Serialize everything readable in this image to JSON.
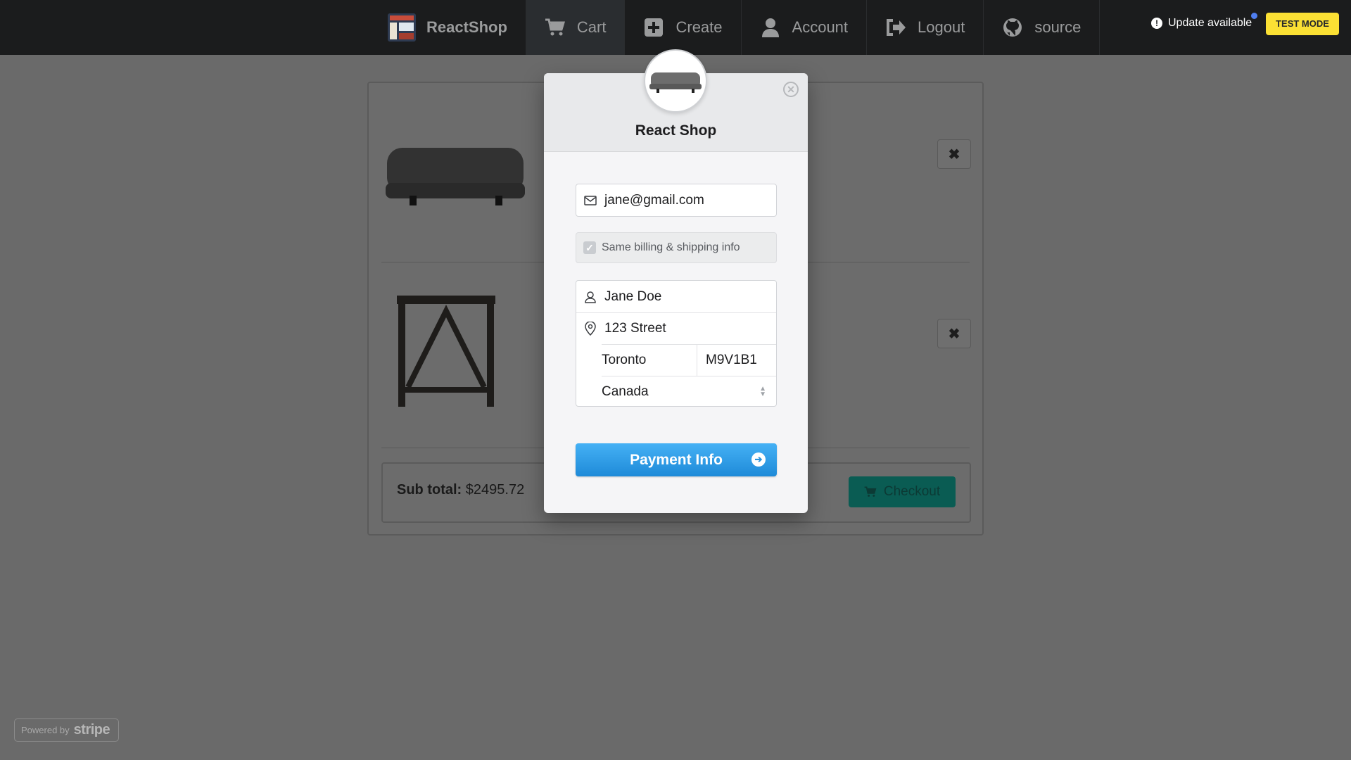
{
  "nav": {
    "brand": "ReactShop",
    "items": [
      {
        "label": "Cart",
        "icon": "cart-icon"
      },
      {
        "label": "Create",
        "icon": "plus-square-icon"
      },
      {
        "label": "Account",
        "icon": "user-icon"
      },
      {
        "label": "Logout",
        "icon": "sign-out-icon"
      },
      {
        "label": "source",
        "icon": "github-icon"
      }
    ],
    "update_label": "Update available",
    "test_mode": "TEST MODE"
  },
  "cart": {
    "items": [
      {
        "image": "ottoman-image",
        "remove_label": "✖"
      },
      {
        "image": "side-table-image",
        "remove_label": "✖"
      }
    ],
    "subtotal_label": "Sub total:",
    "subtotal_value": "$2495.72",
    "checkout_label": "Checkout"
  },
  "modal": {
    "title": "React Shop",
    "close_label": "✕",
    "email": "jane@gmail.com",
    "same_billing_label": "Same billing & shipping info",
    "name": "Jane Doe",
    "street": "123 Street",
    "city": "Toronto",
    "postal": "M9V1B1",
    "country": "Canada",
    "pay_label": "Payment Info",
    "pay_arrow": "➔"
  },
  "stripe": {
    "powered_by": "Powered by",
    "brand": "stripe"
  },
  "colors": {
    "nav_bg": "#1b1c1d",
    "overlay_bg": "#6a6a6a",
    "pay_button": "#2b93dc",
    "test_mode": "#fbe034",
    "checkout": "#0a5c53"
  }
}
